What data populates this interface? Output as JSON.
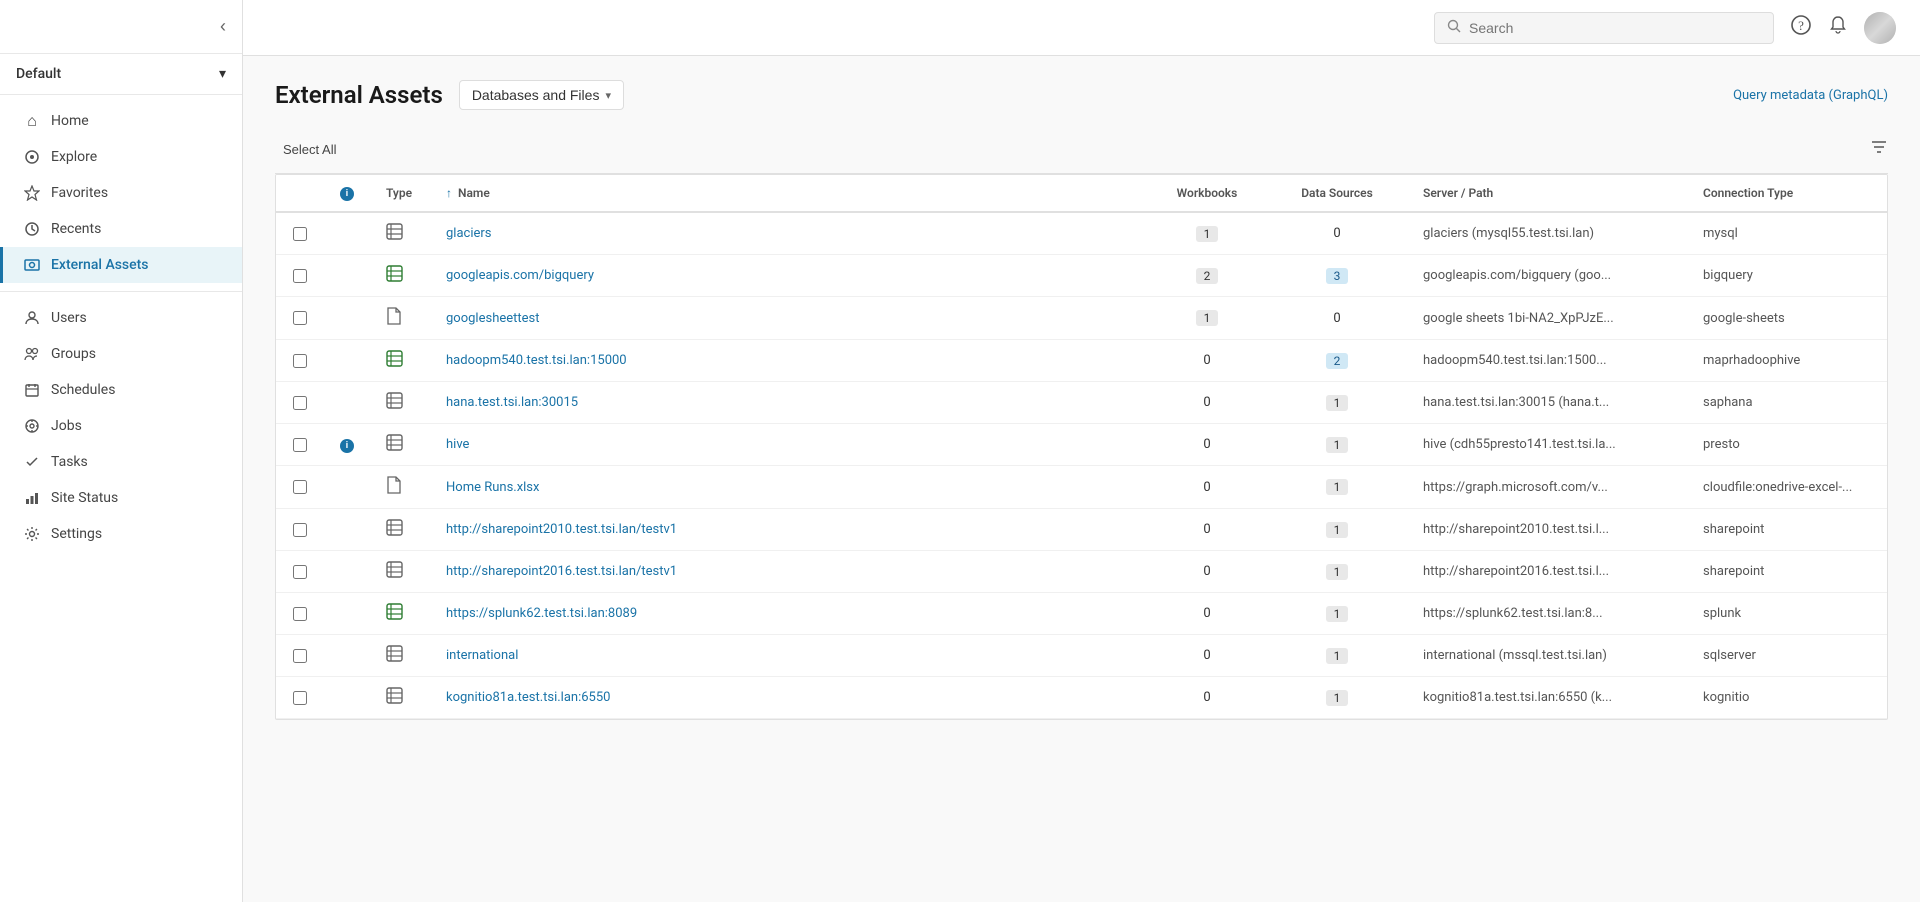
{
  "sidebar": {
    "toggle_label": "‹",
    "workspace": "Default",
    "nav_items": [
      {
        "id": "home",
        "label": "Home",
        "icon": "⌂",
        "active": false
      },
      {
        "id": "explore",
        "label": "Explore",
        "icon": "◎",
        "active": false
      },
      {
        "id": "favorites",
        "label": "Favorites",
        "icon": "☆",
        "active": false
      },
      {
        "id": "recents",
        "label": "Recents",
        "icon": "◷",
        "active": false
      },
      {
        "id": "external-assets",
        "label": "External Assets",
        "icon": "◈",
        "active": true
      }
    ],
    "admin_items": [
      {
        "id": "users",
        "label": "Users",
        "icon": "👤",
        "active": false
      },
      {
        "id": "groups",
        "label": "Groups",
        "icon": "👥",
        "active": false
      },
      {
        "id": "schedules",
        "label": "Schedules",
        "icon": "📅",
        "active": false
      },
      {
        "id": "jobs",
        "label": "Jobs",
        "icon": "⚙",
        "active": false
      },
      {
        "id": "tasks",
        "label": "Tasks",
        "icon": "✓",
        "active": false
      },
      {
        "id": "site-status",
        "label": "Site Status",
        "icon": "📊",
        "active": false
      },
      {
        "id": "settings",
        "label": "Settings",
        "icon": "⚙",
        "active": false
      }
    ]
  },
  "topbar": {
    "search_placeholder": "Search",
    "help_icon": "?",
    "notification_icon": "🔔"
  },
  "page": {
    "title": "External Assets",
    "dropdown_label": "Databases and Files",
    "graphql_link": "Query metadata (GraphQL)",
    "select_all_label": "Select All"
  },
  "table": {
    "columns": [
      {
        "id": "check",
        "label": ""
      },
      {
        "id": "info",
        "label": ""
      },
      {
        "id": "type",
        "label": "Type"
      },
      {
        "id": "name",
        "label": "Name",
        "sorted": true,
        "sort_dir": "asc"
      },
      {
        "id": "workbooks",
        "label": "Workbooks"
      },
      {
        "id": "datasources",
        "label": "Data Sources"
      },
      {
        "id": "server",
        "label": "Server / Path"
      },
      {
        "id": "conntype",
        "label": "Connection Type"
      }
    ],
    "rows": [
      {
        "id": 1,
        "info": false,
        "type": "database",
        "name": "glaciers",
        "workbooks": "1",
        "datasources": "0",
        "server": "glaciers (mysql55.test.tsi.lan)",
        "conntype": "mysql"
      },
      {
        "id": 2,
        "info": false,
        "type": "database-green",
        "name": "googleapis.com/bigquery",
        "workbooks": "2",
        "datasources": "3",
        "server": "googleapis.com/bigquery (goo...",
        "conntype": "bigquery"
      },
      {
        "id": 3,
        "info": false,
        "type": "file",
        "name": "googlesheettest",
        "workbooks": "1",
        "datasources": "0",
        "server": "google sheets 1bi-NA2_XpPJzE...",
        "conntype": "google-sheets"
      },
      {
        "id": 4,
        "info": false,
        "type": "database-green",
        "name": "hadoopm540.test.tsi.lan:15000",
        "workbooks": "0",
        "datasources": "2",
        "server": "hadoopm540.test.tsi.lan:1500...",
        "conntype": "maprhadoophive"
      },
      {
        "id": 5,
        "info": false,
        "type": "database",
        "name": "hana.test.tsi.lan:30015",
        "workbooks": "0",
        "datasources": "1",
        "server": "hana.test.tsi.lan:30015 (hana.t...",
        "conntype": "saphana"
      },
      {
        "id": 6,
        "info": true,
        "type": "database",
        "name": "hive",
        "workbooks": "0",
        "datasources": "1",
        "server": "hive (cdh55presto141.test.tsi.la...",
        "conntype": "presto"
      },
      {
        "id": 7,
        "info": false,
        "type": "file",
        "name": "Home Runs.xlsx",
        "workbooks": "0",
        "datasources": "1",
        "server": "https://graph.microsoft.com/v...",
        "conntype": "cloudfile:onedrive-excel-..."
      },
      {
        "id": 8,
        "info": false,
        "type": "database",
        "name": "http://sharepoint2010.test.tsi.lan/testv1",
        "workbooks": "0",
        "datasources": "1",
        "server": "http://sharepoint2010.test.tsi.l...",
        "conntype": "sharepoint"
      },
      {
        "id": 9,
        "info": false,
        "type": "database",
        "name": "http://sharepoint2016.test.tsi.lan/testv1",
        "workbooks": "0",
        "datasources": "1",
        "server": "http://sharepoint2016.test.tsi.l...",
        "conntype": "sharepoint"
      },
      {
        "id": 10,
        "info": false,
        "type": "database-green",
        "name": "https://splunk62.test.tsi.lan:8089",
        "workbooks": "0",
        "datasources": "1",
        "server": "https://splunk62.test.tsi.lan:8...",
        "conntype": "splunk"
      },
      {
        "id": 11,
        "info": false,
        "type": "database",
        "name": "international",
        "workbooks": "0",
        "datasources": "1",
        "server": "international (mssql.test.tsi.lan)",
        "conntype": "sqlserver"
      },
      {
        "id": 12,
        "info": false,
        "type": "database",
        "name": "kognitio81a.test.tsi.lan:6550",
        "workbooks": "0",
        "datasources": "1",
        "server": "kognitio81a.test.tsi.lan:6550 (k...",
        "conntype": "kognitio"
      }
    ]
  }
}
